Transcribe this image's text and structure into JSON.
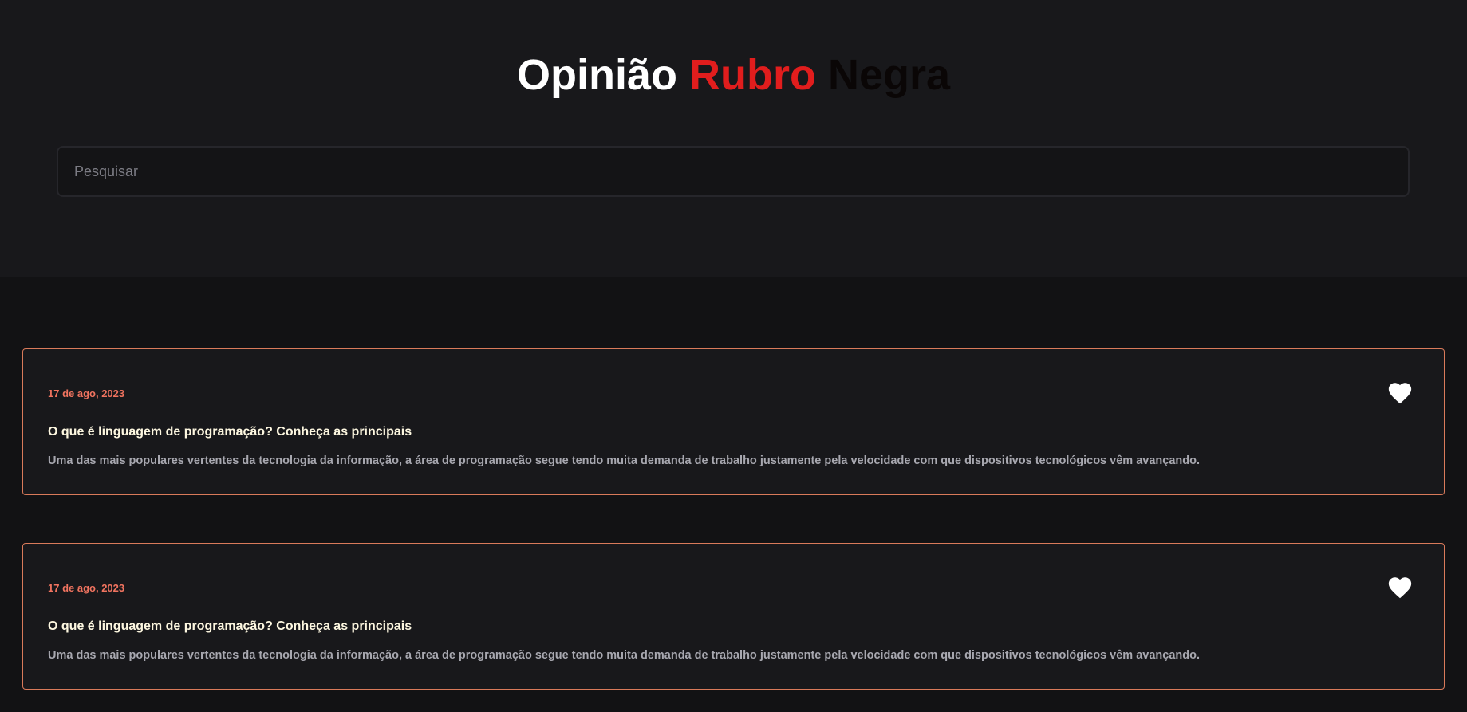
{
  "header": {
    "title_part1": "Opinião",
    "title_part2": "Rubro",
    "title_part3": "Negra"
  },
  "search": {
    "placeholder": "Pesquisar",
    "value": ""
  },
  "posts": [
    {
      "date": "17 de ago, 2023",
      "title": "O que é linguagem de programação? Conheça as principais",
      "description": "Uma das mais populares vertentes da tecnologia da informação, a área de programação segue tendo muita demanda de trabalho justamente pela velocidade com que dispositivos tecnológicos vêm avançando.",
      "icon": "heart-icon"
    },
    {
      "date": "17 de ago, 2023",
      "title": "O que é linguagem de programação? Conheça as principais",
      "description": "Uma das mais populares vertentes da tecnologia da informação, a área de programação segue tendo muita demanda de trabalho justamente pela velocidade com que dispositivos tecnológicos vêm avançando.",
      "icon": "heart-icon"
    }
  ],
  "colors": {
    "background": "#121214",
    "header_background": "#18181b",
    "accent_red": "#e11d1d",
    "card_border": "#d97a5a",
    "date_color": "#f0735f",
    "title_color": "#fdf7e0"
  }
}
